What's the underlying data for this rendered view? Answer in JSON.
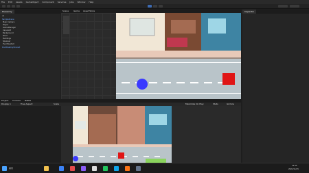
{
  "menu": [
    "File",
    "Edit",
    "Assets",
    "GameObject",
    "Component",
    "Services",
    "Jobs",
    "Window",
    "Help"
  ],
  "hierarchy": {
    "tab": "Hierarchy",
    "search_placeholder": "All",
    "scene": "SampleScene",
    "items": [
      "Main Camera",
      "Player",
      "GameManager",
      "CanvasUI",
      "Background",
      "Road",
      "Buildings",
      "Spawner",
      "EventSystem"
    ],
    "extra": "DontDestroyOnLoad"
  },
  "scene_tabs": [
    "Scene",
    "Game",
    "Asset Store"
  ],
  "inspector": {
    "tab": "Inspector"
  },
  "bottom_tabs": [
    "Project",
    "Console",
    "Game"
  ],
  "game_toolbar": {
    "display": "Display 1",
    "aspect": "Free Aspect",
    "scale": "Scale",
    "maximize": "Maximize On Play",
    "stats": "Stats",
    "gizmos": "Gizmos"
  },
  "taskbar": {
    "search": "検索",
    "time": "12:45",
    "date": "2021/11/15"
  },
  "colors": {
    "player": "#3a3aff",
    "obstacle": "#e01515",
    "road": "#b9c4c9",
    "sidewalk": "#e8c9b8",
    "lane": "#ffffff"
  }
}
